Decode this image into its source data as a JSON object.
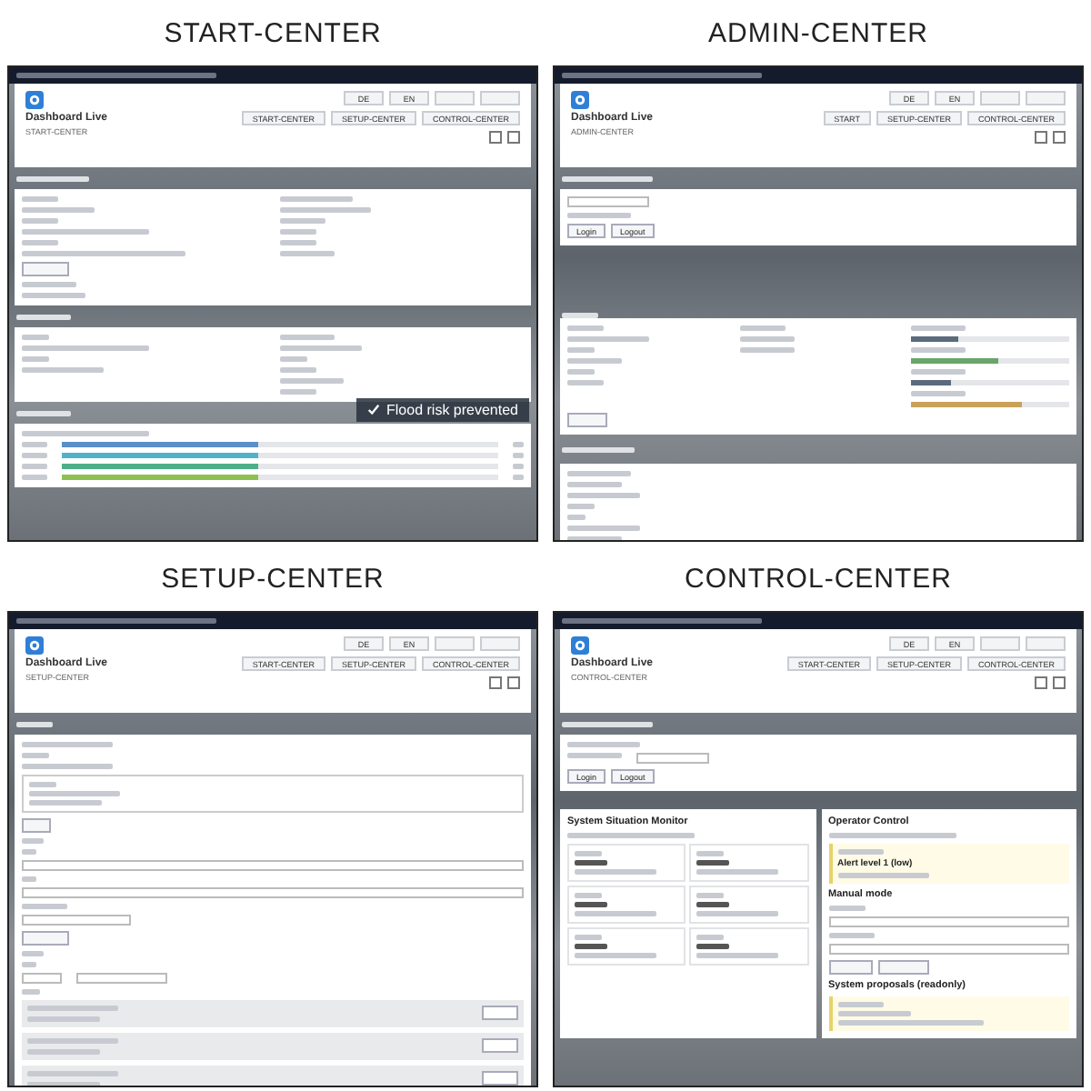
{
  "panels": [
    {
      "kind": "start",
      "label": "START-CENTER",
      "app_title": "Dashboard Live",
      "subtitle": "START-CENTER",
      "nav_buttons": [
        "START-CENTER",
        "SETUP-CENTER",
        "CONTROL-CENTER"
      ],
      "lang_buttons": [
        "DE",
        "EN"
      ],
      "overlay": "Flood risk prevented",
      "bars": [
        {
          "level": 0.45,
          "color": "#5b8fc9"
        },
        {
          "level": 0.45,
          "color": "#4fb3c8"
        },
        {
          "level": 0.45,
          "color": "#4caf8a"
        },
        {
          "level": 0.45,
          "color": "#8cc152"
        }
      ]
    },
    {
      "kind": "admin",
      "label": "ADMIN-CENTER",
      "app_title": "Dashboard Live",
      "subtitle": "ADMIN-CENTER",
      "nav_buttons": [
        "START",
        "SETUP-CENTER",
        "CONTROL-CENTER"
      ],
      "lang_buttons": [
        "DE",
        "EN"
      ],
      "auth_buttons": [
        "Login",
        "Logout"
      ],
      "meters": [
        {
          "level": 0.3,
          "color": "#5a6b7d"
        },
        {
          "level": 0.55,
          "color": "#6aa56a"
        },
        {
          "level": 0.25,
          "color": "#5a6b7d"
        },
        {
          "level": 0.7,
          "color": "#c9a25a"
        }
      ]
    },
    {
      "kind": "setup",
      "label": "SETUP-CENTER",
      "app_title": "Dashboard Live",
      "subtitle": "SETUP-CENTER",
      "nav_buttons": [
        "START-CENTER",
        "SETUP-CENTER",
        "CONTROL-CENTER"
      ],
      "lang_buttons": [
        "DE",
        "EN"
      ]
    },
    {
      "kind": "control",
      "label": "CONTROL-CENTER",
      "app_title": "Dashboard Live",
      "subtitle": "CONTROL-CENTER",
      "nav_buttons": [
        "START-CENTER",
        "SETUP-CENTER",
        "CONTROL-CENTER"
      ],
      "lang_buttons": [
        "DE",
        "EN"
      ],
      "auth_buttons": [
        "Login",
        "Logout"
      ],
      "monitor_title": "System Situation Monitor",
      "operator_title": "Operator Control",
      "alert": "Alert level 1 (low)",
      "manual_title": "Manual mode",
      "proposals_title": "System proposals (readonly)"
    }
  ]
}
